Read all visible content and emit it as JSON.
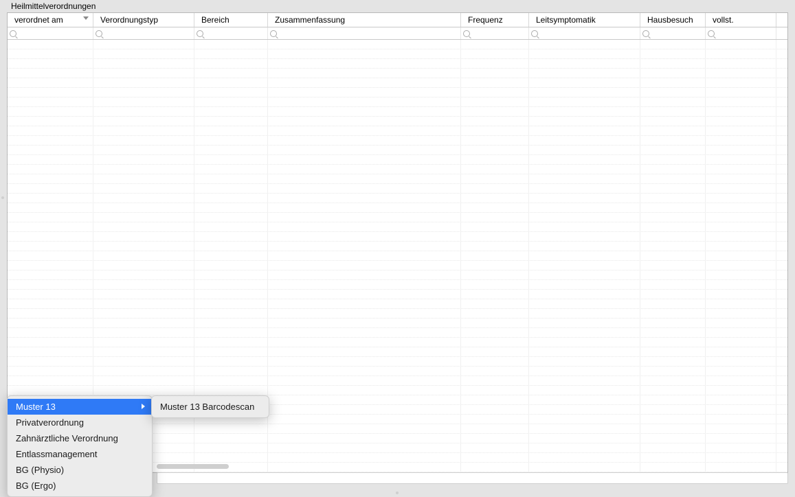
{
  "panel": {
    "title": "Heilmittelverordnungen"
  },
  "columns": [
    {
      "label": "verordnet am",
      "sorted": true
    },
    {
      "label": "Verordnungstyp",
      "sorted": false
    },
    {
      "label": "Bereich",
      "sorted": false
    },
    {
      "label": "Zusammenfassung",
      "sorted": false
    },
    {
      "label": "Frequenz",
      "sorted": false
    },
    {
      "label": "Leitsymptomatik",
      "sorted": false
    },
    {
      "label": "Hausbesuch",
      "sorted": false
    },
    {
      "label": "vollst.",
      "sorted": false
    }
  ],
  "context_menu": {
    "items": [
      {
        "label": "Muster 13",
        "selected": true,
        "has_submenu": true
      },
      {
        "label": "Privatverordnung",
        "selected": false,
        "has_submenu": false
      },
      {
        "label": "Zahnärztliche Verordnung",
        "selected": false,
        "has_submenu": false
      },
      {
        "label": "Entlassmanagement",
        "selected": false,
        "has_submenu": false
      },
      {
        "label": "BG (Physio)",
        "selected": false,
        "has_submenu": false
      },
      {
        "label": "BG (Ergo)",
        "selected": false,
        "has_submenu": false
      }
    ],
    "submenu": [
      {
        "label": "Muster 13 Barcodescan"
      }
    ]
  }
}
